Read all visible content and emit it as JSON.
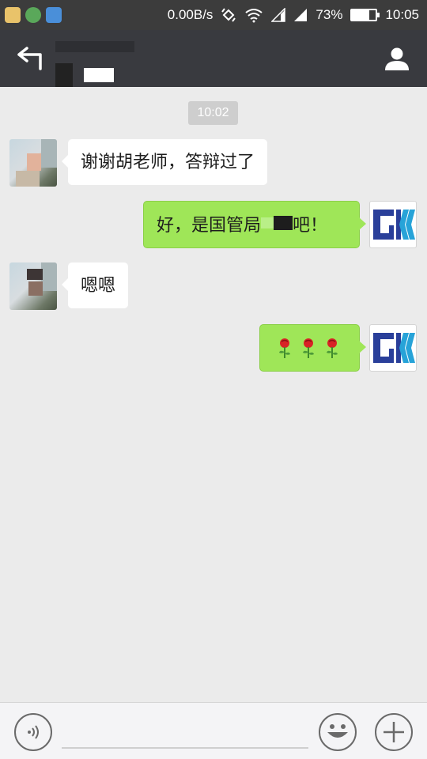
{
  "status_bar": {
    "network_speed": "0.00B/s",
    "battery_percent": "73%",
    "battery_level": 0.73,
    "time": "10:05"
  },
  "header": {
    "back_icon": "back-arrow-icon",
    "profile_icon": "person-icon"
  },
  "chat": {
    "timestamp": "10:02",
    "messages": [
      {
        "from": "friend",
        "text": "谢谢胡老师，答辩过了"
      },
      {
        "from": "self",
        "text_before": "好，是国管局",
        "text_after": "吧！"
      },
      {
        "from": "friend",
        "text": "嗯嗯"
      },
      {
        "from": "self",
        "emoji": "🌹🌹🌹",
        "emoji_name": "rose"
      }
    ]
  },
  "input_bar": {
    "voice_icon": "voice-icon",
    "emoji_icon": "emoji-icon",
    "plus_icon": "plus-icon",
    "input_value": ""
  },
  "colors": {
    "self_bubble": "#9fe658",
    "friend_bubble": "#ffffff",
    "title_bar": "#393a3f",
    "background": "#ebebeb"
  }
}
